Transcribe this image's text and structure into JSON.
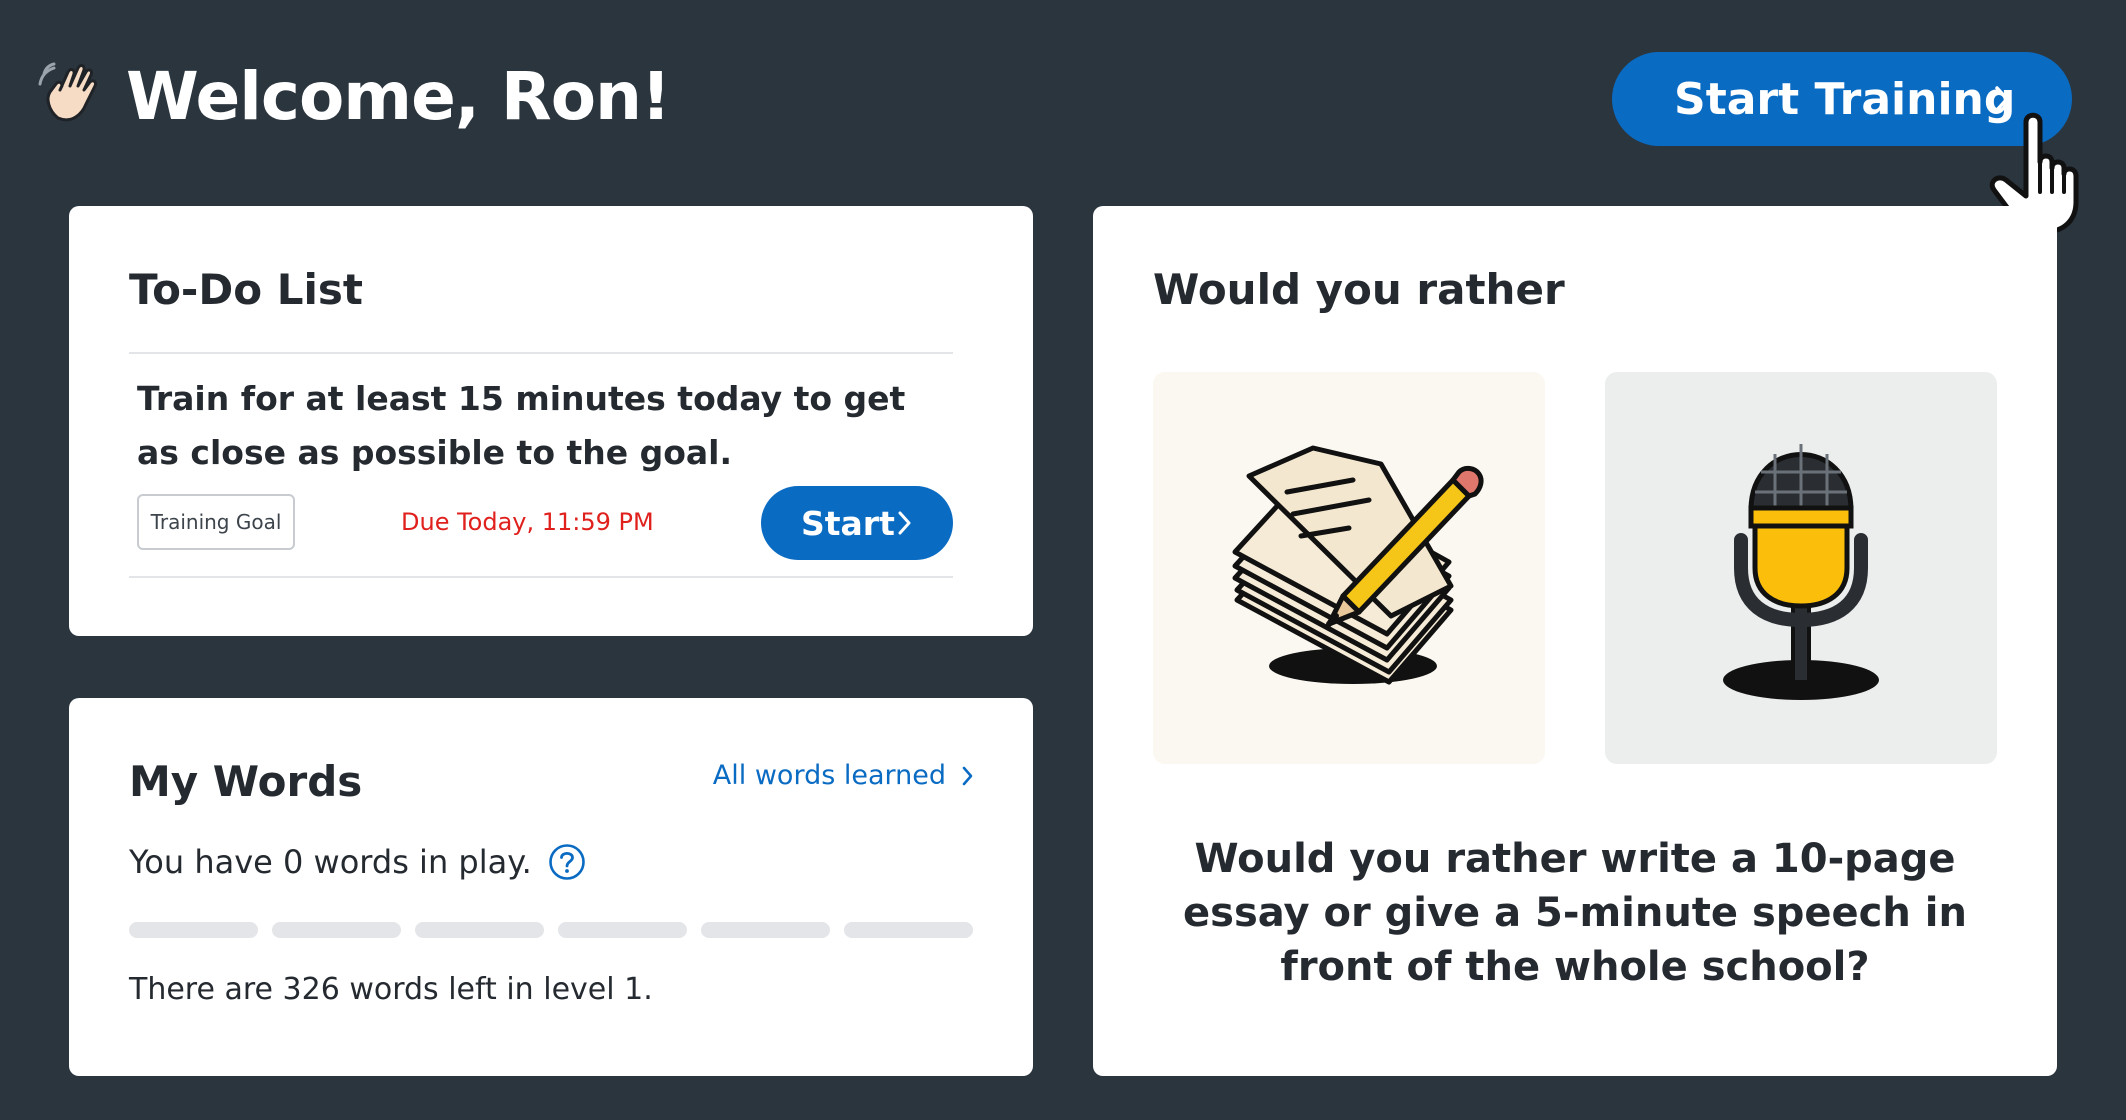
{
  "header": {
    "greeting": "Welcome, Ron!",
    "greeting_icon": "waving-hand-icon",
    "start_training_label": "Start Training"
  },
  "todo": {
    "title": "To-Do List",
    "task_text": "Train for at least 15 minutes today to get as close as possible to the goal.",
    "tag": "Training Goal",
    "due": "Due Today, 11:59 PM",
    "start_label": "Start"
  },
  "my_words": {
    "title": "My Words",
    "link_label": "All words learned",
    "in_play": "You have 0 words in play.",
    "progress_segments": 6,
    "progress_filled": 0,
    "remaining": "There are 326 words left in level 1."
  },
  "would_you_rather": {
    "title": "Would you rather",
    "option_a_icon": "paper-and-pencil-icon",
    "option_b_icon": "microphone-icon",
    "question": "Would you rather write a 10-page essay or give a 5-minute speech in front of the whole school?"
  },
  "colors": {
    "background": "#2b353e",
    "accent": "#0a6bc3",
    "due": "#e0201c",
    "mic_yellow": "#fbbf0b"
  }
}
